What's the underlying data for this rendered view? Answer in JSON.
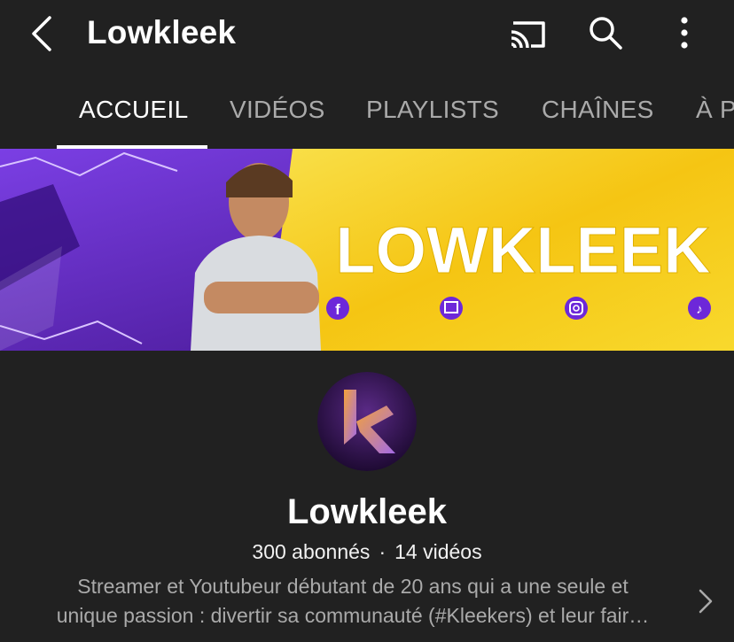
{
  "header": {
    "title": "Lowkleek",
    "icons": [
      "back-icon",
      "cast-icon",
      "search-icon",
      "more-vertical-icon"
    ]
  },
  "tabs": [
    {
      "label": "ACCUEIL",
      "active": true
    },
    {
      "label": "VIDÉOS",
      "active": false
    },
    {
      "label": "PLAYLISTS",
      "active": false
    },
    {
      "label": "CHAÎNES",
      "active": false
    },
    {
      "label": "À P",
      "active": false
    }
  ],
  "banner": {
    "text": "LOWKLEEK",
    "social_icons": [
      "facebook-icon",
      "twitch-icon",
      "instagram-icon",
      "tiktok-icon"
    ],
    "colors": {
      "purple": "#5b21b6",
      "yellow": "#f5d213"
    }
  },
  "channel": {
    "name": "Lowkleek",
    "subscribers": "300 abonnés",
    "separator": "·",
    "videos": "14 vidéos",
    "description_line1": "Streamer et Youtubeur débutant de 20 ans qui a une seule et",
    "description_line2": "unique passion : divertir sa communauté (#Kleekers) et leur fair…"
  },
  "theme": {
    "background": "#212121",
    "text": "#ffffff",
    "muted": "#aaaaaa"
  }
}
